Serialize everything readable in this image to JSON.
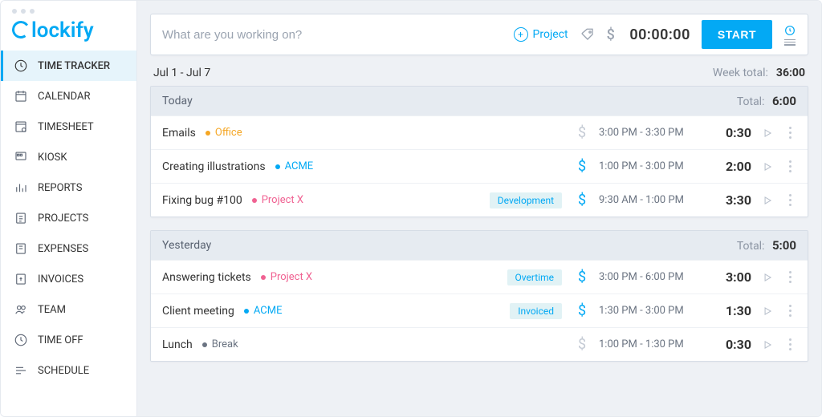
{
  "logo_text": "lockify",
  "sidebar": {
    "items": [
      {
        "label": "TIME TRACKER",
        "icon": "clock-icon",
        "active": true
      },
      {
        "label": "CALENDAR",
        "icon": "calendar-icon"
      },
      {
        "label": "TIMESHEET",
        "icon": "timesheet-icon"
      },
      {
        "label": "KIOSK",
        "icon": "kiosk-icon"
      },
      {
        "label": "REPORTS",
        "icon": "reports-icon"
      },
      {
        "label": "PROJECTS",
        "icon": "projects-icon"
      },
      {
        "label": "EXPENSES",
        "icon": "expenses-icon"
      },
      {
        "label": "INVOICES",
        "icon": "invoices-icon"
      },
      {
        "label": "TEAM",
        "icon": "team-icon"
      },
      {
        "label": "TIME OFF",
        "icon": "timeoff-icon"
      },
      {
        "label": "SCHEDULE",
        "icon": "schedule-icon"
      }
    ]
  },
  "timer_bar": {
    "placeholder": "What are you working on?",
    "project_label": "Project",
    "elapsed": "00:00:00",
    "start_label": "START"
  },
  "range": "Jul 1 - Jul 7",
  "week_total_label": "Week total:",
  "week_total": "36:00",
  "groups": [
    {
      "title": "Today",
      "total_label": "Total:",
      "total": "6:00",
      "entries": [
        {
          "desc": "Emails",
          "project": "Office",
          "project_color": "#f5a623",
          "tag": "",
          "billable": false,
          "range": "3:00 PM - 3:30 PM",
          "dur": "0:30"
        },
        {
          "desc": "Creating illustrations",
          "project": "ACME",
          "project_color": "#03a9f4",
          "tag": "",
          "billable": true,
          "range": "1:00 PM - 3:00 PM",
          "dur": "2:00"
        },
        {
          "desc": "Fixing bug #100",
          "project": "Project X",
          "project_color": "#f06292",
          "tag": "Development",
          "billable": true,
          "range": "9:30 AM - 1:00 PM",
          "dur": "3:30"
        }
      ]
    },
    {
      "title": "Yesterday",
      "total_label": "Total:",
      "total": "5:00",
      "entries": [
        {
          "desc": "Answering tickets",
          "project": "Project X",
          "project_color": "#f06292",
          "tag": "Overtime",
          "billable": true,
          "range": "3:00 PM - 6:00 PM",
          "dur": "3:00"
        },
        {
          "desc": "Client meeting",
          "project": "ACME",
          "project_color": "#03a9f4",
          "tag": "Invoiced",
          "billable": true,
          "range": "1:30 PM - 3:00 PM",
          "dur": "1:30"
        },
        {
          "desc": "Lunch",
          "project": "Break",
          "project_color": "#6b7482",
          "tag": "",
          "billable": false,
          "range": "1:00 PM - 1:30 PM",
          "dur": "0:30"
        }
      ]
    }
  ]
}
